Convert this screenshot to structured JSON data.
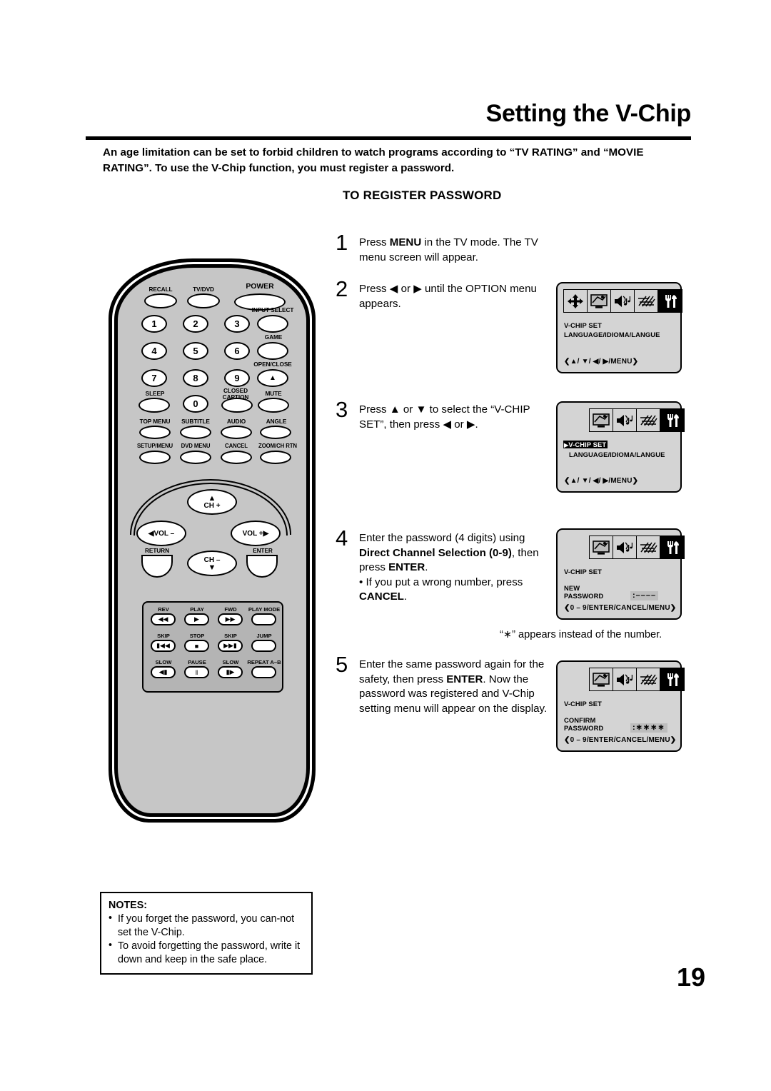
{
  "header": {
    "title": "Setting the V-Chip",
    "intro": "An age limitation can be set to forbid children to watch programs according to “TV RATING” and “MOVIE RATING”. To use the V-Chip function, you must register a password.",
    "section_heading": "TO REGISTER PASSWORD"
  },
  "steps": [
    {
      "number": "1",
      "text_html": "Press <b>MENU</b> in the TV mode. The TV menu screen will appear."
    },
    {
      "number": "2",
      "text_html": "Press ◀ or ▶ until the OPTION menu appears."
    },
    {
      "number": "3",
      "text_html": "Press ▲ or ▼ to select the “V-CHIP SET”, then press ◀ or ▶."
    },
    {
      "number": "4",
      "text_html": "Enter the password (4 digits) using <b>Direct Channel Selection (0-9)</b>, then press <b>ENTER</b>.",
      "bullet_html": "• If you put a wrong number, press <b>CANCEL</b>."
    },
    {
      "number": "5",
      "text_html": "Enter the same password again for the safety, then press <b>ENTER</b>. Now the password was registered and V-Chip setting menu will appear on the display."
    }
  ],
  "star_note": "“∗” appears instead of the number.",
  "osd": {
    "nav_hint_menu": "❮▲/ ▼/ ◀/ ▶/MENU❯",
    "nav_hint_enter": "❮0 – 9/ENTER/CANCEL/MENU❯",
    "box1": {
      "icons": [
        "navigation-icon",
        "picture-icon",
        "audio-icon",
        "antenna-icon",
        "setup-icon"
      ],
      "line1": "V-CHIP SET",
      "line2": "LANGUAGE/IDIOMA/LANGUE"
    },
    "box2": {
      "icons": [
        "picture-icon",
        "audio-icon",
        "antenna-icon",
        "setup-icon"
      ],
      "line1": "V-CHIP SET",
      "line1_selected": true,
      "line2": "LANGUAGE/IDIOMA/LANGUE"
    },
    "box3": {
      "icons": [
        "picture-icon",
        "audio-icon",
        "antenna-icon",
        "setup-icon"
      ],
      "title": "V-CHIP SET",
      "label_line1": "NEW",
      "label_line2": "PASSWORD",
      "value": ":––––"
    },
    "box4": {
      "icons": [
        "picture-icon",
        "audio-icon",
        "antenna-icon",
        "setup-icon"
      ],
      "title": "V-CHIP SET",
      "label_line1": "CONFIRM",
      "label_line2": "PASSWORD",
      "value": ":∗∗∗∗"
    }
  },
  "remote": {
    "row_top": [
      "RECALL",
      "TV/DVD",
      "POWER"
    ],
    "keypad": {
      "keys": [
        "1",
        "2",
        "3",
        "4",
        "5",
        "6",
        "7",
        "8",
        "9",
        "0"
      ],
      "right_labels": [
        "INPUT SELECT",
        "GAME",
        "OPEN/CLOSE"
      ]
    },
    "fn_row1": [
      "SLEEP",
      "CLOSED CAPTION",
      "MUTE"
    ],
    "fn_row2": [
      "TOP MENU",
      "SUBTITLE",
      "AUDIO",
      "ANGLE"
    ],
    "fn_row3": [
      "SETUP/MENU",
      "DVD MENU",
      "CANCEL",
      "ZOOM/CH RTN"
    ],
    "nav": {
      "ch_up": "CH +",
      "ch_down": "CH –",
      "vol_down": "VOL –",
      "vol_up": "VOL +",
      "return": "RETURN",
      "enter": "ENTER"
    },
    "dvd_panel": [
      {
        "label": "REV",
        "glyph": "◀◀"
      },
      {
        "label": "PLAY",
        "glyph": "▶"
      },
      {
        "label": "FWD",
        "glyph": "▶▶"
      },
      {
        "label": "PLAY MODE",
        "glyph": ""
      },
      {
        "label": "SKIP",
        "glyph": "▮◀◀"
      },
      {
        "label": "STOP",
        "glyph": "■"
      },
      {
        "label": "SKIP",
        "glyph": "▶▶▮"
      },
      {
        "label": "JUMP",
        "glyph": ""
      },
      {
        "label": "SLOW",
        "glyph": "◀▮"
      },
      {
        "label": "PAUSE",
        "glyph": "‖"
      },
      {
        "label": "SLOW",
        "glyph": "▮▶"
      },
      {
        "label": "REPEAT A–B",
        "glyph": ""
      }
    ]
  },
  "notes": {
    "heading": "NOTES:",
    "items": [
      "If you forget the password, you can-not set the V-Chip.",
      "To avoid forgetting the password, write it down and keep in the safe place."
    ]
  },
  "page_number": "19"
}
